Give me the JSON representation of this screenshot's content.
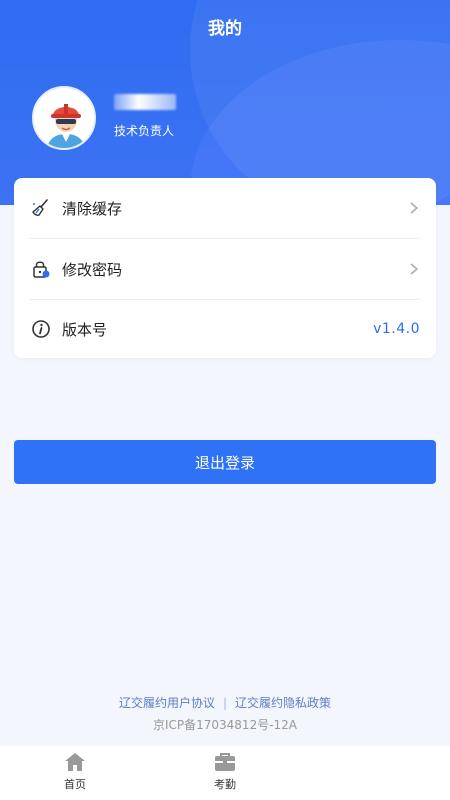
{
  "header": {
    "title": "我的"
  },
  "profile": {
    "role": "技术负责人"
  },
  "settings": {
    "items": [
      {
        "label": "清除缓存",
        "icon": "broom-icon"
      },
      {
        "label": "修改密码",
        "icon": "lock-icon"
      },
      {
        "label": "版本号",
        "icon": "info-icon",
        "value": "v1.4.0"
      }
    ]
  },
  "logout": {
    "label": "退出登录"
  },
  "footer": {
    "user_agreement": "辽交履约用户协议",
    "separator": "|",
    "privacy_policy": "辽交履约隐私政策",
    "icp": "京ICP备17034812号-12A"
  },
  "tabbar": {
    "tabs": [
      {
        "label": "首页",
        "icon": "home-icon"
      },
      {
        "label": "考勤",
        "icon": "briefcase-icon"
      }
    ]
  },
  "colors": {
    "primary": "#2f6cf2",
    "background": "#f3f6fc"
  }
}
